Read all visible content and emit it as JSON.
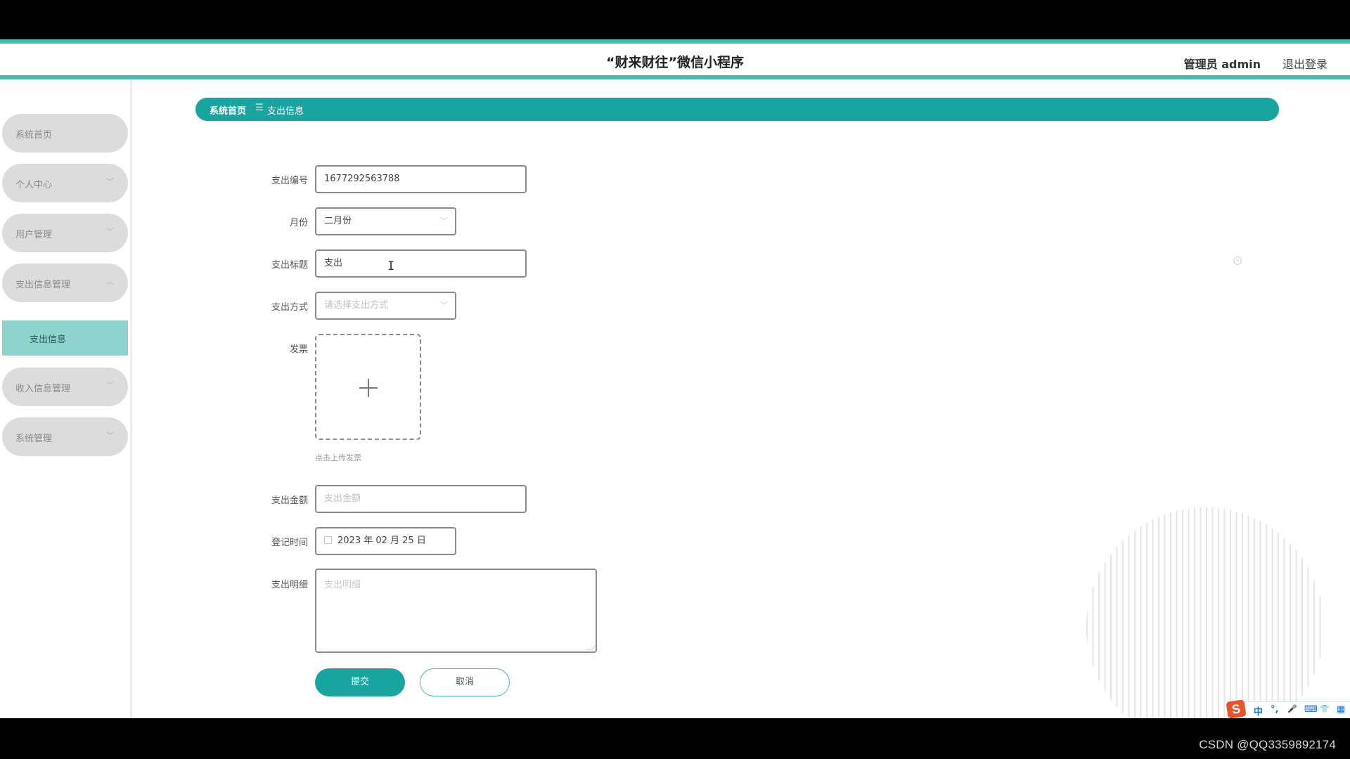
{
  "header": {
    "title": "“财来财往”微信小程序",
    "user": "管理员 admin",
    "logout": "退出登录"
  },
  "sidebar": {
    "items": [
      {
        "label": "系统首页",
        "chevron": ""
      },
      {
        "label": "个人中心",
        "chevron": "﹀"
      },
      {
        "label": "用户管理",
        "chevron": "﹀"
      },
      {
        "label": "支出信息管理",
        "chevron": "︿"
      },
      {
        "label": "收入信息管理",
        "chevron": "﹀"
      },
      {
        "label": "系统管理",
        "chevron": "﹀"
      }
    ],
    "submenu": [
      {
        "label": "支出信息",
        "active": true
      }
    ]
  },
  "breadcrumb": {
    "home": "系统首页",
    "separator": "☰",
    "current": "支出信息"
  },
  "form": {
    "expense_no": {
      "label": "支出编号",
      "value": "1677292563788"
    },
    "month": {
      "label": "月份",
      "value": "二月份",
      "chevron": "﹀"
    },
    "title": {
      "label": "支出标题",
      "value": "支出"
    },
    "method": {
      "label": "支出方式",
      "placeholder": "请选择支出方式",
      "chevron": "﹀"
    },
    "invoice": {
      "label": "发票",
      "tip": "点击上传发票",
      "icon": "plus-icon"
    },
    "amount": {
      "label": "支出金额",
      "placeholder": "支出金额"
    },
    "reg_time": {
      "label": "登记时间",
      "value": "2023 年 02 月 25 日",
      "icon": "calendar-icon"
    },
    "detail": {
      "label": "支出明细",
      "placeholder": "支出明细"
    },
    "submit": "提交",
    "cancel": "取消"
  },
  "overlay": {
    "cursor": "I",
    "clear_icon": "×",
    "ime": {
      "logo": "S",
      "items": [
        "中",
        "°,",
        "🎤",
        "⌨",
        "👕",
        "▦"
      ]
    },
    "watermark": "CSDN @QQ3359892174"
  },
  "colors": {
    "accent": "#1aa49f",
    "header_border": "#4bb7b2",
    "submenu_active": "#8fd3ce",
    "menu_bg": "#dcdcdc"
  }
}
